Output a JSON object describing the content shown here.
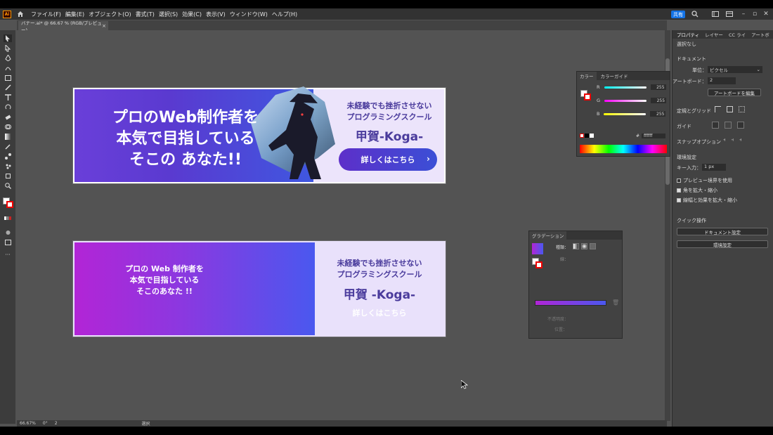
{
  "menubar": {
    "app_logo": "Ai",
    "items": [
      "ファイル(F)",
      "編集(E)",
      "オブジェクト(O)",
      "書式(T)",
      "選択(S)",
      "効果(C)",
      "表示(V)",
      "ウィンドウ(W)",
      "ヘルプ(H)"
    ],
    "share": "共有"
  },
  "doc_tab": {
    "title": "バナー.ai* @ 66.67 % (RGB/プレビュー)",
    "close": "×"
  },
  "banner1": {
    "headline_l1": "プロのWeb制作者を",
    "headline_l2": "本気で目指している",
    "headline_l3": "そこの あなた!!",
    "sub_l1": "未経験でも挫折させない",
    "sub_l2": "プログラミングスクール",
    "name": "甲賀-Koga-",
    "button": "詳しくはこちら",
    "chev": "›"
  },
  "banner2": {
    "headline_l1": "プロの Web 制作者を",
    "headline_l2": "本気で目指している",
    "headline_l3": "そこのあなた !!",
    "sub_l1": "未経験でも挫折させない",
    "sub_l2": "プログラミングスクール",
    "name": "甲賀 -Koga-",
    "link": "詳しくはこちら"
  },
  "color_panel": {
    "tab1": "カラー",
    "tab2": "カラーガイド",
    "r_label": "R",
    "g_label": "G",
    "b_label": "B",
    "r": "255",
    "g": "255",
    "b": "255",
    "hex_prefix": "#",
    "hex": "ffffff"
  },
  "gradient_panel": {
    "tab": "グラデーション",
    "type_label": "種類：",
    "line_label": "線：",
    "opacity_label": "不透明度：",
    "position_label": "位置："
  },
  "properties": {
    "tabs": [
      "プロパティ",
      "レイヤー",
      "CC ライ",
      "アートボ"
    ],
    "selection": "選択なし",
    "document": "ドキュメント",
    "unit_label": "単位：",
    "unit": "ピクセル",
    "artboard_label": "アートボード：",
    "artboard": "2",
    "edit_artboard": "アートボードを編集",
    "rulers_grid": "定規とグリッド",
    "guides": "ガイド",
    "snap": "スナップオプション",
    "prefs": "環境設定",
    "keyinput_label": "キー入力：",
    "keyinput": "1 px",
    "chk_preview": "プレビュー境界を使用",
    "chk_corners": "角を拡大・縮小",
    "chk_strokes": "線幅と効果を拡大・縮小",
    "quick": "クイック操作",
    "doc_settings": "ドキュメント設定",
    "env_settings": "環境設定"
  },
  "statusbar": {
    "zoom": "66.67%",
    "rotate": "0°",
    "artboard": "2",
    "mode": "選択"
  },
  "colors": {
    "accent": "#1473e6",
    "banner_purple": "#6a3fd9",
    "banner_blue": "#4a58ef",
    "banner_magenta": "#b225d6",
    "text_navy": "#4a3b9c"
  }
}
